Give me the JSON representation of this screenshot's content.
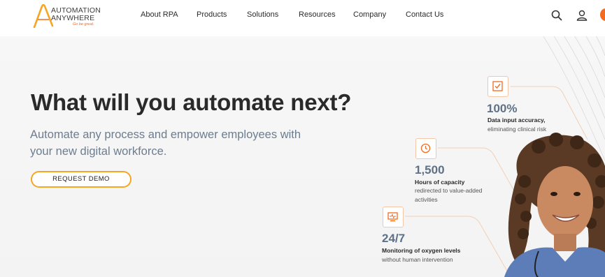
{
  "logo": {
    "line1": "AUTOMATION",
    "line2": "ANYWHERE",
    "tagline": "Go be great."
  },
  "nav": [
    {
      "label": "About RPA"
    },
    {
      "label": "Products"
    },
    {
      "label": "Solutions"
    },
    {
      "label": "Resources"
    },
    {
      "label": "Company"
    },
    {
      "label": "Contact Us"
    }
  ],
  "header_icons": [
    "search-icon",
    "user-icon"
  ],
  "hero": {
    "title": "What will you automate next?",
    "subtitle": "Automate any process and empower employees with your new digital workforce.",
    "cta_label": "REQUEST DEMO"
  },
  "stats": [
    {
      "icon": "checkbox-icon",
      "value": "100%",
      "label": "Data input accuracy,",
      "desc": "eliminating clinical risk"
    },
    {
      "icon": "clock-icon",
      "value": "1,500",
      "label": "Hours of capacity",
      "desc": "redirected to value-added activities"
    },
    {
      "icon": "monitor-icon",
      "value": "24/7",
      "label": "Monitoring of oxygen levels",
      "desc": "without human intervention"
    }
  ],
  "colors": {
    "accent_orange": "#f26b21",
    "cta_border": "#f5a623",
    "stat_value": "#5e7186",
    "subtitle": "#6c7d90",
    "title": "#2a2a2a"
  }
}
